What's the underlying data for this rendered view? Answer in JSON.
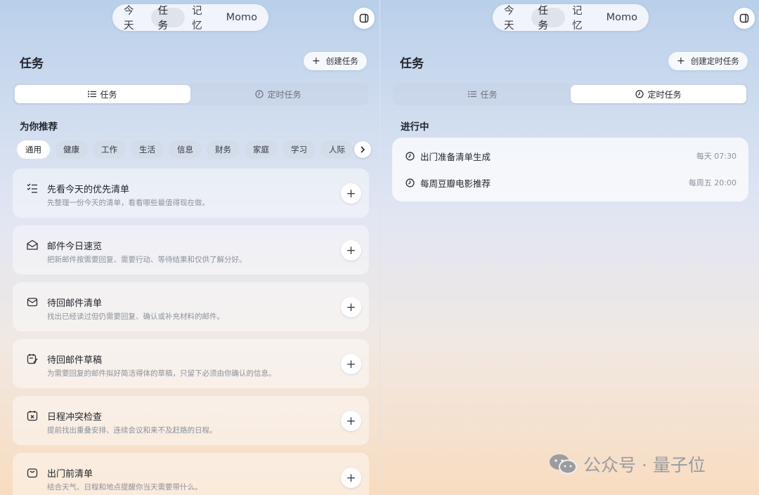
{
  "nav": {
    "tabs": [
      "今天",
      "任务",
      "记忆",
      "Momo"
    ],
    "active_left": 1,
    "active_right": 1
  },
  "left": {
    "title": "任务",
    "create_label": "创建任务",
    "segment": {
      "tasks": "任务",
      "scheduled": "定时任务",
      "active": "tasks"
    },
    "section_title": "为你推荐",
    "chips": [
      "通用",
      "健康",
      "工作",
      "生活",
      "信息",
      "财务",
      "家庭",
      "学习",
      "人际"
    ],
    "active_chip": 0,
    "cards": [
      {
        "icon": "checklist-icon",
        "title": "先看今天的优先清单",
        "desc": "先整理一份今天的清单，看看哪些最值得现在做。"
      },
      {
        "icon": "mail-open-icon",
        "title": "邮件今日速览",
        "desc": "把新邮件按需要回复、需要行动、等待结果和仅供了解分好。"
      },
      {
        "icon": "mail-icon",
        "title": "待回邮件清单",
        "desc": "找出已经读过但仍需要回复、确认或补充材料的邮件。"
      },
      {
        "icon": "draft-edit-icon",
        "title": "待回邮件草稿",
        "desc": "为需要回复的邮件拟好简洁得体的草稿，只留下必须由你确认的信息。"
      },
      {
        "icon": "calendar-conflict-icon",
        "title": "日程冲突检查",
        "desc": "提前找出重叠安排、连续会议和来不及赶路的日程。"
      },
      {
        "icon": "bag-icon",
        "title": "出门前清单",
        "desc": "结合天气、日程和地点提醒你当天需要带什么。"
      }
    ]
  },
  "right": {
    "title": "任务",
    "create_label": "创建定时任务",
    "segment": {
      "tasks": "任务",
      "scheduled": "定时任务",
      "active": "scheduled"
    },
    "section_title": "进行中",
    "running": [
      {
        "name": "出门准备清单生成",
        "time": "每天 07:30"
      },
      {
        "name": "每周豆瓣电影推荐",
        "time": "每周五 20:00"
      }
    ]
  },
  "watermark": {
    "text": "公众号 · 量子位",
    "icon": "wechat-icon"
  },
  "colors": {
    "accent_active_tab": "#dfe4ec",
    "card_bg": "#ffffff",
    "muted_text": "#8c919c"
  }
}
